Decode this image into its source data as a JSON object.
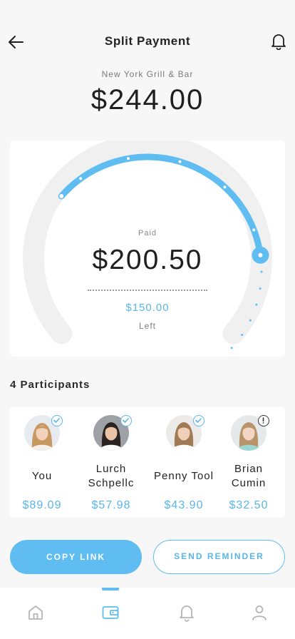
{
  "header": {
    "title": "Split Payment",
    "back_icon": "arrow-left-icon",
    "notification_icon": "bell-icon"
  },
  "bill": {
    "restaurant": "New York Grill & Bar",
    "total": "$244.00"
  },
  "gauge": {
    "paid_label": "Paid",
    "paid_amount": "$200.50",
    "left_amount": "$150.00",
    "left_label": "Left",
    "progress_fraction": 0.5,
    "accent_color": "#5fbdf1",
    "track_color": "#f0f0f0"
  },
  "participants": {
    "heading": "4 Participants",
    "items": [
      {
        "name": "You",
        "amount": "$89.09",
        "status": "paid",
        "status_icon": "check-icon"
      },
      {
        "name": "Lurch Schpellc",
        "amount": "$57.98",
        "status": "paid",
        "status_icon": "check-icon"
      },
      {
        "name": "Penny Tool",
        "amount": "$43.90",
        "status": "paid",
        "status_icon": "check-icon"
      },
      {
        "name": "Brian Cumin",
        "amount": "$32.50",
        "status": "pending",
        "status_icon": "exclamation-icon"
      }
    ]
  },
  "actions": {
    "copy_link": "COPY LINK",
    "send_reminder": "SEND REMINDER"
  },
  "tabbar": {
    "tabs": [
      {
        "icon": "home-icon",
        "active": false
      },
      {
        "icon": "wallet-icon",
        "active": true
      },
      {
        "icon": "bell-icon",
        "active": false
      },
      {
        "icon": "user-icon",
        "active": false
      }
    ]
  }
}
